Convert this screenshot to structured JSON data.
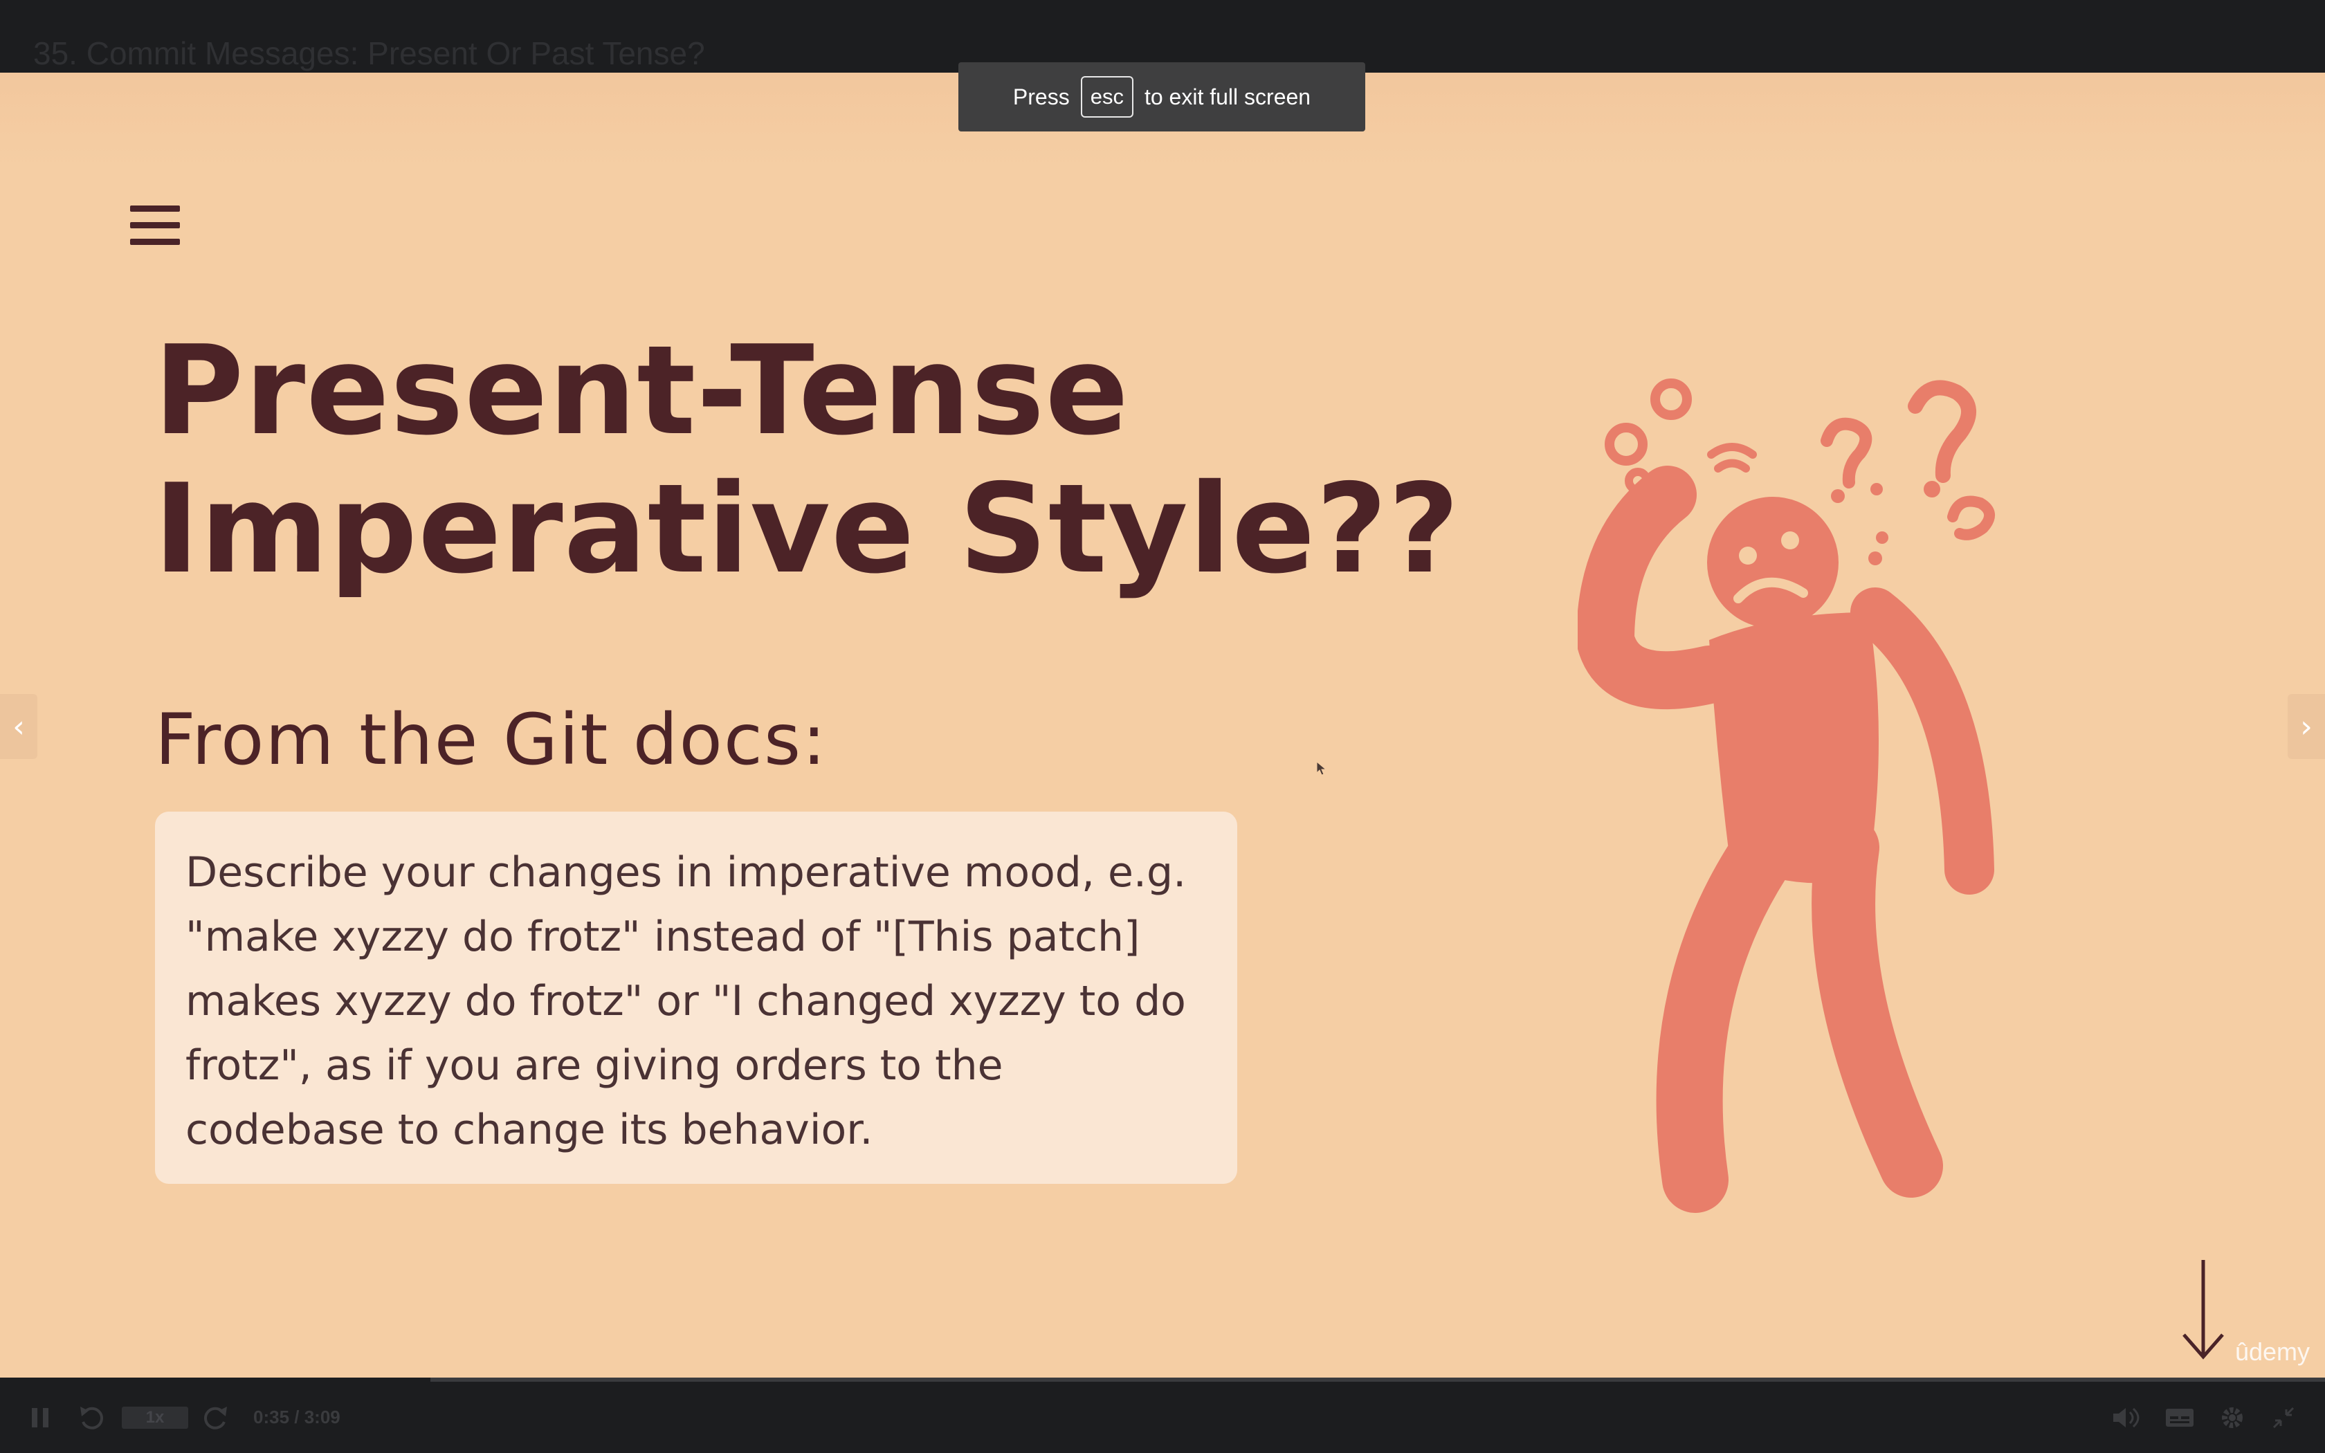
{
  "window": {
    "lecture_title": "35. Commit Messages: Present Or Past Tense?"
  },
  "fullscreen_toast": {
    "prefix": "Press",
    "key": "esc",
    "suffix": "to exit full screen"
  },
  "slide": {
    "title_line1": "Present-Tense",
    "title_line2": "Imperative Style??",
    "subtitle": "From the Git docs:",
    "quote": "Describe your changes in imperative mood, e.g. \"make xyzzy do frotz\" instead of \"[This patch] makes xyzzy do frotz\" or \"I changed xyzzy to do frotz\", as if you are giving orders to the codebase to change its behavior.",
    "illustration": "confused-person-icon",
    "menu_icon": "hamburger-menu-icon",
    "scroll_icon": "down-arrow-icon"
  },
  "navigation": {
    "prev_glyph": "‹",
    "next_glyph": "›"
  },
  "watermark": "ûdemy",
  "player": {
    "speed": "1x",
    "current_time": "0:35",
    "duration": "3:09",
    "time_display": "0:35 / 3:09",
    "progress_fraction": 0.185,
    "icons": [
      "pause-icon",
      "rewind-icon",
      "forward-icon",
      "volume-icon",
      "captions-icon",
      "settings-icon",
      "exit-fullscreen-icon"
    ]
  },
  "colors": {
    "slide_background": "#f5cea4",
    "title_color": "#4c2327",
    "quote_box": "#fae6d3",
    "illustration": "#e87e6a",
    "chrome": "#1c1d1f"
  }
}
